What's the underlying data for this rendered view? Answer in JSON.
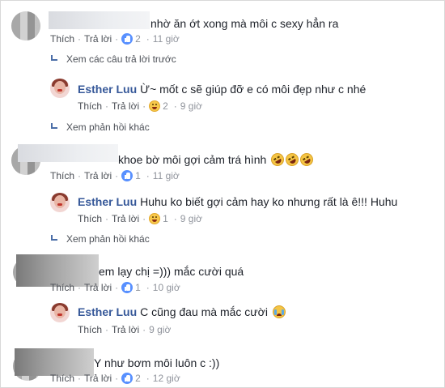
{
  "action_labels": {
    "like": "Thích",
    "reply": "Trả lời",
    "sep": "·"
  },
  "comments": [
    {
      "text": "nhờ ăn ớt xong mà môi c sexy hẳn ra",
      "reaction_count": "2",
      "time": "11 giờ"
    },
    {
      "text": "khoe bờ môi gợi cảm trá hình",
      "reaction_count": "1",
      "time": "11 giờ"
    },
    {
      "text": "em lạy chị =))) mắc cười quá",
      "reaction_count": "1",
      "time": "10 giờ"
    },
    {
      "text": "Y như bơm môi luôn c :))",
      "reaction_count": "2",
      "time": "12 giờ"
    }
  ],
  "replies": [
    {
      "name": "Esther Luu",
      "text": "Ừ~ mốt c sẽ giúp đỡ e có môi đẹp như c nhé",
      "reaction_count": "2",
      "time": "9 giờ"
    },
    {
      "name": "Esther Luu",
      "text": "Huhu ko biết gợi cảm hay ko nhưng rất là ê!!! Huhu",
      "reaction_count": "1",
      "time": "9 giờ"
    },
    {
      "name": "Esther Luu",
      "text": "C cũng đau mà mắc cười",
      "time": "9 giờ"
    }
  ],
  "links": {
    "previous_replies": "Xem các câu trả lời trước",
    "more_replies_1": "Xem phản hồi khác",
    "more_replies_2": "Xem phản hồi khác"
  },
  "icons": {
    "like": "like-badge-icon",
    "haha": "haha-badge-icon",
    "rofl": "rofl-emoji-icon",
    "cry": "crying-laughing-emoji-icon",
    "reply": "reply-arrow-icon"
  },
  "colors": {
    "name": "#365899",
    "action": "#90949c",
    "like_badge": "#5890ff"
  }
}
